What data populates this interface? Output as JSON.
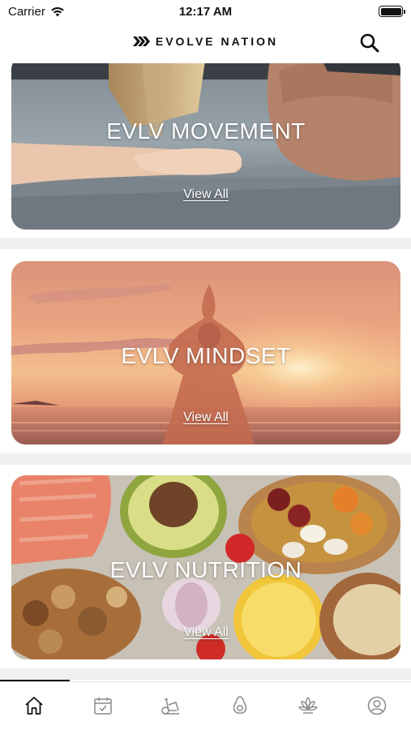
{
  "status_bar": {
    "carrier": "Carrier",
    "time": "12:17 AM"
  },
  "header": {
    "brand": "EVOLVE NATION"
  },
  "cards": [
    {
      "title": "EVLV MOVEMENT",
      "link": "View All"
    },
    {
      "title": "EVLV MINDSET",
      "link": "View All"
    },
    {
      "title": "EVLV NUTRITION",
      "link": "View All"
    }
  ],
  "tab_bar": {
    "tabs": [
      "home-icon",
      "calendar-icon",
      "exercise-bike-icon",
      "avocado-icon",
      "lotus-icon",
      "profile-icon"
    ],
    "active": 0
  }
}
